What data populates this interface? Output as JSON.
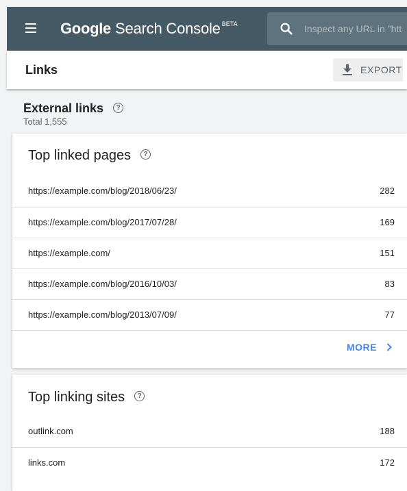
{
  "app": {
    "brand": "Google",
    "product": "Search Console",
    "badge": "BETA",
    "search_placeholder": "Inspect any URL in \"htt"
  },
  "page": {
    "title": "Links",
    "export_label": "EXPORT"
  },
  "external_links": {
    "title": "External links",
    "total": "Total 1,555"
  },
  "top_linked_pages": {
    "title": "Top linked pages",
    "rows": [
      {
        "url": "https://example.com/blog/2018/06/23/",
        "count": "282"
      },
      {
        "url": "https://example.com/blog/2017/07/28/",
        "count": "169"
      },
      {
        "url": "https://example.com/",
        "count": "151"
      },
      {
        "url": "https://example.com/blog/2016/10/03/",
        "count": "83"
      },
      {
        "url": "https://example.com/blog/2013/07/09/",
        "count": "77"
      }
    ],
    "more_label": "MORE"
  },
  "top_linking_sites": {
    "title": "Top linking sites",
    "rows": [
      {
        "site": "outlink.com",
        "count": "188"
      },
      {
        "site": "links.com",
        "count": "172"
      }
    ]
  },
  "colors": {
    "header_bg": "#455a64",
    "search_bg": "#5f737e",
    "accent": "#4285f4",
    "page_bg": "#f1f3f4"
  },
  "icons": {
    "menu": "hamburger-icon",
    "search": "search-icon",
    "export": "download-icon",
    "help": "help-circle-icon",
    "more": "chevron-right-icon"
  }
}
